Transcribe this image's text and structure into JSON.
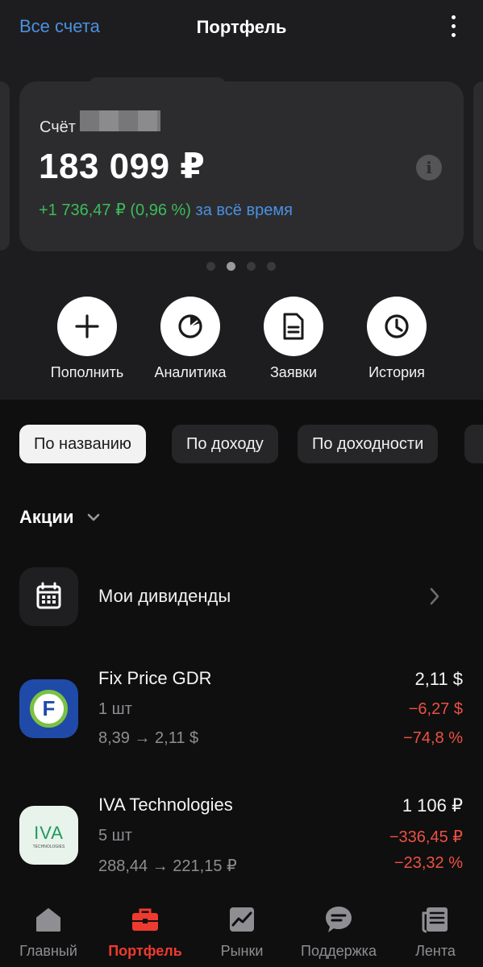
{
  "header": {
    "back_label": "Все счета",
    "title": "Портфель"
  },
  "account_card": {
    "account_label": "Счёт",
    "balance": "183 099 ₽",
    "gain": "+1 736,47 ₽ (0,96 %)",
    "gain_period": "за всё время",
    "pager": {
      "total": 4,
      "active_index": 1
    }
  },
  "actions": [
    {
      "label": "Пополнить",
      "icon": "plus-icon"
    },
    {
      "label": "Аналитика",
      "icon": "pie-chart-icon"
    },
    {
      "label": "Заявки",
      "icon": "document-icon"
    },
    {
      "label": "История",
      "icon": "clock-icon"
    }
  ],
  "sort_chips": [
    {
      "label": "По названию",
      "active": true
    },
    {
      "label": "По доходу",
      "active": false
    },
    {
      "label": "По доходности",
      "active": false
    }
  ],
  "section": {
    "title": "Акции"
  },
  "dividends": {
    "label": "Мои дивиденды",
    "icon": "calendar-icon"
  },
  "assets": [
    {
      "name": "Fix Price GDR",
      "quantity": "1 шт",
      "price_change": "8,39 → 2,11 $",
      "value": "2,11 $",
      "pnl": "−6,27 $",
      "pnl_pct": "−74,8 %",
      "logo_letters": "F",
      "colors": {
        "bg": "#1f4aa8",
        "ring": "#7cc242"
      }
    },
    {
      "name": "IVA Technologies",
      "quantity": "5 шт",
      "price_change": "288,44 → 221,15 ₽",
      "value": "1 106 ₽",
      "pnl": "−336,45 ₽",
      "pnl_pct": "−23,32 %",
      "logo_letters": "IVA",
      "logo_sub": "TECHNOLOGIES",
      "colors": {
        "bg": "#e8f3ec",
        "text": "#1f9a5b"
      }
    }
  ],
  "tabbar": [
    {
      "label": "Главный",
      "icon": "home-icon",
      "active": false
    },
    {
      "label": "Портфель",
      "icon": "briefcase-icon",
      "active": true
    },
    {
      "label": "Рынки",
      "icon": "chart-icon",
      "active": false
    },
    {
      "label": "Поддержка",
      "icon": "chat-bubble-icon",
      "active": false
    },
    {
      "label": "Лента",
      "icon": "news-icon",
      "active": false
    }
  ],
  "colors": {
    "accent_blue": "#4a90e2",
    "positive": "#3dbb5a",
    "negative": "#ee5044",
    "active_tab": "#ef3a2f"
  }
}
